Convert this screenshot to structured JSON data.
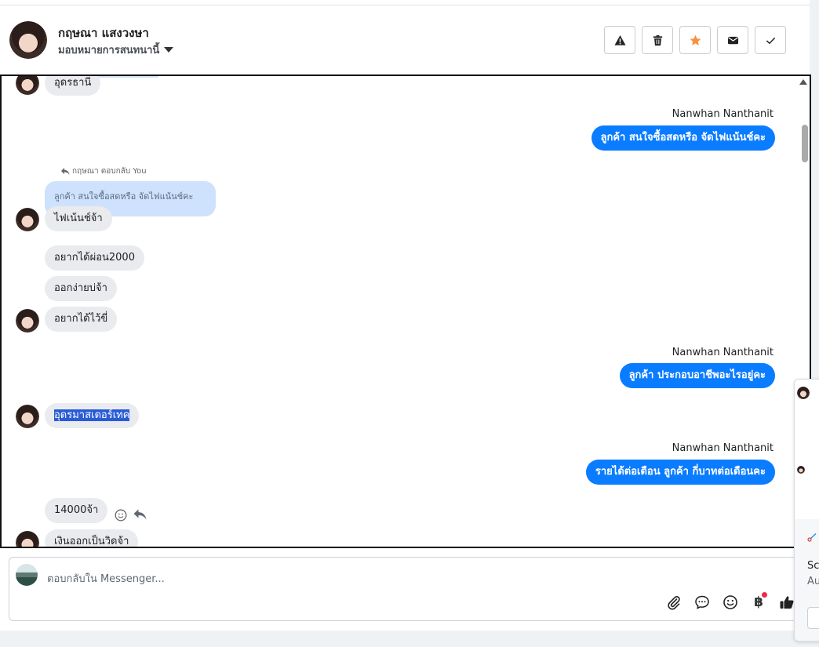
{
  "header": {
    "name": "กฤษณา แสงวงษา",
    "assign_label": "มอบหมายการสนทนานี้",
    "buttons": [
      {
        "name": "report-button",
        "icon": "warning-icon"
      },
      {
        "name": "delete-button",
        "icon": "trash-icon"
      },
      {
        "name": "star-button",
        "icon": "star-icon",
        "color": "#f5923e"
      },
      {
        "name": "mark-unread-button",
        "icon": "envelope-icon"
      },
      {
        "name": "done-button",
        "icon": "check-icon"
      }
    ]
  },
  "messages": {
    "m1": "อุดรธานี",
    "sender1": "Nanwhan Nanthanit",
    "m2": "ลูกค้า สนใจซื้อสดหรือ จัดไฟแน้นช์คะ",
    "reply_note": "กฤษณา ตอบกลับ You",
    "quoted": "ลูกค้า สนใจซื้อสดหรือ จัดไฟแน้นช์คะ",
    "m3": "ไฟเน้นช์จ้า",
    "m4": "อยากได้ผ่อน2000",
    "m5": "ออกง่ายบ่จ้า",
    "m6": "อยากได้ไว้ขี่",
    "sender2": "Nanwhan Nanthanit",
    "m7": "ลูกค้า ประกอบอาชีพอะไรอยู่คะ",
    "m8": "อุดรมาสเตอร์เทค",
    "sender3": "Nanwhan Nanthanit",
    "m9": "รายได้ต่อเดือน ลูกค้า กี่บาทต่อเดือนคะ",
    "m10": "14000จ้า",
    "m11": "เงินออกเป็นวิดจ้า"
  },
  "composer": {
    "placeholder": "ตอบกลับใน Messenger...",
    "icons": [
      "paperclip-icon",
      "chat-bubble-icon",
      "emoji-icon",
      "baht-icon",
      "thumbs-up-icon"
    ],
    "baht_symbol": "฿"
  },
  "popup": {
    "title_fragment": "Scr",
    "subtitle_fragment": "Au"
  },
  "colors": {
    "outgoing_bubble": "#0a7cff",
    "incoming_bubble": "#e9ebee",
    "quoted_bubble": "#cfe2fd"
  }
}
